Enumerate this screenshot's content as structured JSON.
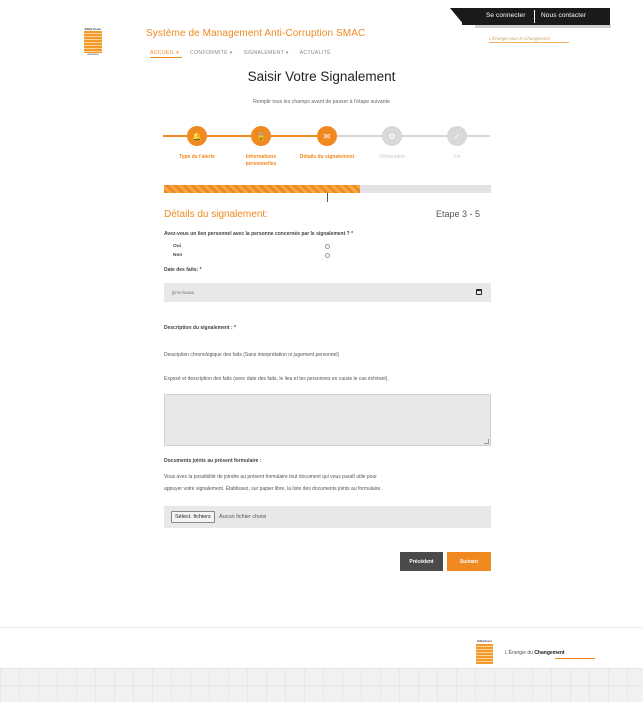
{
  "topbar": {
    "login": "Se connecter",
    "contact": "Nous contacter"
  },
  "header": {
    "logo_top": "Ethiq'Assur",
    "logo_bottom": "assurance",
    "site_title": "Système de Management Anti-Corruption SMAC",
    "tagline": "L'Énergie pour le Changement"
  },
  "nav": {
    "items": [
      {
        "label": "ACCUEIL ▾"
      },
      {
        "label": "CONFORMITÉ ▾"
      },
      {
        "label": "SIGNALEMENT ▾"
      },
      {
        "label": "ACTUALITÉ"
      }
    ]
  },
  "page": {
    "title": "Saisir Votre Signalement",
    "subtitle": "Remplir tous les champs avant de passer à l'étape suivante"
  },
  "stepper": {
    "steps": [
      {
        "label": "Type de l'alerte",
        "icon": "bell-icon",
        "glyph": "🔔",
        "state": "done"
      },
      {
        "label": "Informations personnelles",
        "icon": "lock-icon",
        "glyph": "🔒",
        "state": "done"
      },
      {
        "label": "Détails du signalement",
        "icon": "envelope-icon",
        "glyph": "✉",
        "state": "current"
      },
      {
        "label": "Déclaration",
        "icon": "gear-icon",
        "glyph": "⚙",
        "state": "todo"
      },
      {
        "label": "Fin",
        "icon": "check-icon",
        "glyph": "✓",
        "state": "todo"
      }
    ],
    "progress_fraction": 0.6
  },
  "form": {
    "section_title": "Détails du signalement:",
    "step_counter": "Etape 3 - 5",
    "q_link": "Avez-vous un lien personnel avec la personne concernée par le signalement ? *",
    "opt_yes": "Oui",
    "opt_no": "Non",
    "q_date": "Date des faits: *",
    "date_placeholder": "jj/mm/aaaa",
    "q_description": "Description du signalement : *",
    "desc_help1": "Description chronologique des faits (Sans interprétation ni jugement personnel)",
    "desc_help2": "Exposé et description des faits (avec date des faits, le lieu et les personnes en cause le cas échéant).",
    "q_documents": "Documents joints au présent formulaire :",
    "docs_help1": "Vous avez la possibilité de joindre au présent formulaire tout document qui vous paraît utile pour",
    "docs_help2": "appuyer votre signalement. Établissez, sur papier libre, la liste des documents joints au formulaire.",
    "file_button": "Sélect. fichiers",
    "file_none": "Aucun fichier choisi",
    "btn_prev": "Précédent",
    "btn_next": "Suivant"
  },
  "footer": {
    "logo_top": "Ethiq'Assur",
    "tag_prefix": "L'Énergie du ",
    "tag_bold": "Changement"
  },
  "colors": {
    "accent": "#f0891f",
    "dark": "#1a1a1a",
    "field_bg": "#e8e8e8"
  }
}
